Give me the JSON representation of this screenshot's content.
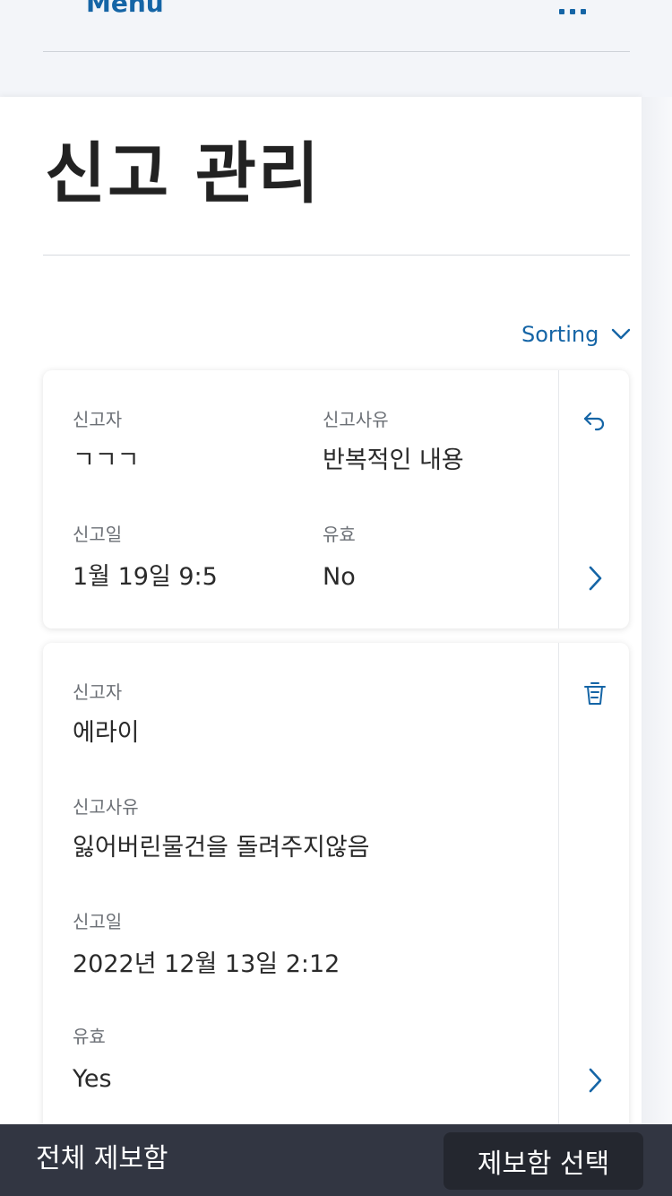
{
  "header": {
    "menu_label": "Menu",
    "menu_icon": "grid-icon"
  },
  "page": {
    "title": "신고 관리"
  },
  "sorting": {
    "label": "Sorting",
    "icon": "chevron-down-icon"
  },
  "labels": {
    "reporter": "신고자",
    "reason": "신고사유",
    "date": "신고일",
    "valid": "유효"
  },
  "reports": [
    {
      "reporter": "ㄱㄱㄱ",
      "reason": "반복적인 내용",
      "date": "1월 19일 9:5",
      "valid": "No",
      "action_icon": "undo-arrow-icon"
    },
    {
      "reporter": "에라이",
      "reason": "잃어버린물건을 돌려주지않음",
      "date": "2022년 12월 13일 2:12",
      "valid": "Yes",
      "action_icon": "trash-icon"
    }
  ],
  "bottom_bar": {
    "bulk_label": "전체 제보함",
    "select_label": "제보함 선택"
  },
  "colors": {
    "accent": "#1565a6",
    "bottom_bar": "#323642",
    "select_button": "#24272f"
  }
}
